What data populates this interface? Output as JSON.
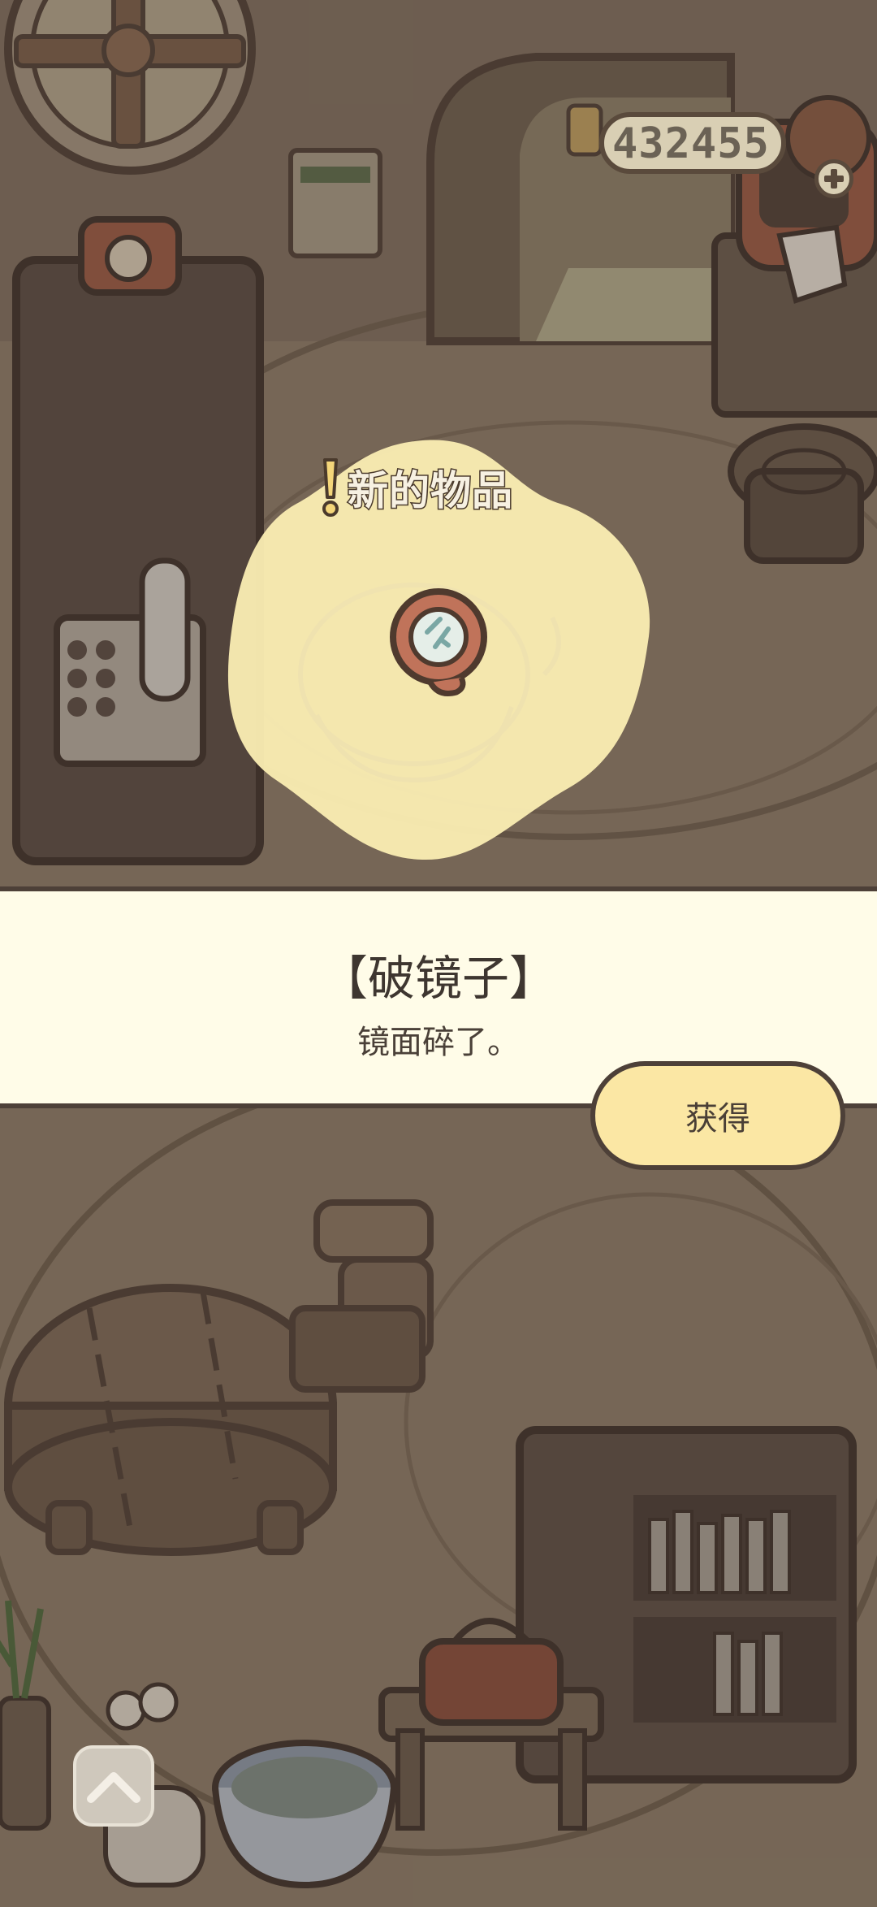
{
  "hud": {
    "coin_count": "432455",
    "add_coins_icon": "plus-icon"
  },
  "popup": {
    "header_label": "新的物品",
    "header_icon": "exclamation-icon",
    "item_icon": "broken-mirror-icon",
    "item_name": "【破镜子】",
    "item_description": "镜面碎了。",
    "obtain_button_label": "获得"
  },
  "navigation": {
    "expand_icon": "chevron-up-icon"
  },
  "colors": {
    "banner_background": "#fffce8",
    "button_background": "#fbe7a4",
    "burst_background": "#fbeeb3",
    "outline": "#4d4038"
  }
}
